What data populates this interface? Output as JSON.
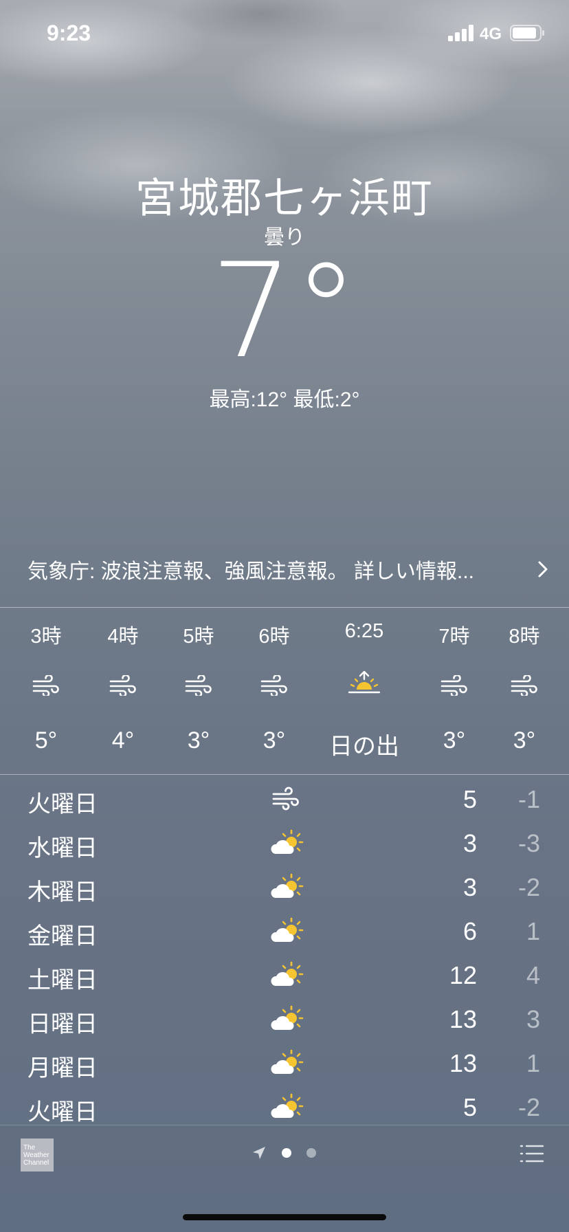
{
  "status_bar": {
    "time": "9:23",
    "network": "4G",
    "icons": [
      "signal-bars-icon",
      "battery-icon"
    ]
  },
  "header": {
    "location": "宮城郡七ヶ浜町",
    "condition": "曇り",
    "temperature": "7°",
    "hi_lo": "最高:12° 最低:2°"
  },
  "alert": {
    "text": "気象庁: 波浪注意報、強風注意報。 詳しい情報...",
    "icon": "chevron-right-icon"
  },
  "hourly": [
    {
      "time": "3時",
      "icon": "wind-icon",
      "temp": "5°"
    },
    {
      "time": "4時",
      "icon": "wind-icon",
      "temp": "4°"
    },
    {
      "time": "5時",
      "icon": "wind-icon",
      "temp": "3°"
    },
    {
      "time": "6時",
      "icon": "wind-icon",
      "temp": "3°"
    },
    {
      "time": "6:25",
      "icon": "sunrise-icon",
      "temp": "日の出"
    },
    {
      "time": "7時",
      "icon": "wind-icon",
      "temp": "3°"
    },
    {
      "time": "8時",
      "icon": "wind-icon",
      "temp": "3°"
    }
  ],
  "daily": [
    {
      "day": "火曜日",
      "icon": "wind-icon",
      "high": "5",
      "low": "-1"
    },
    {
      "day": "水曜日",
      "icon": "partly-cloudy-icon",
      "high": "3",
      "low": "-3"
    },
    {
      "day": "木曜日",
      "icon": "partly-cloudy-icon",
      "high": "3",
      "low": "-2"
    },
    {
      "day": "金曜日",
      "icon": "partly-cloudy-icon",
      "high": "6",
      "low": "1"
    },
    {
      "day": "土曜日",
      "icon": "partly-cloudy-icon",
      "high": "12",
      "low": "4"
    },
    {
      "day": "日曜日",
      "icon": "partly-cloudy-icon",
      "high": "13",
      "low": "3"
    },
    {
      "day": "月曜日",
      "icon": "partly-cloudy-icon",
      "high": "13",
      "low": "1"
    },
    {
      "day": "火曜日",
      "icon": "partly-cloudy-icon",
      "high": "5",
      "low": "-2"
    }
  ],
  "footer": {
    "logo_lines": [
      "The",
      "Weather",
      "Channel"
    ],
    "page_dots": 2,
    "active_page": 1,
    "icons": [
      "location-arrow-icon",
      "list-icon"
    ]
  },
  "colors": {
    "sun": "#f5c531",
    "text": "#ffffff",
    "muted_text": "rgba(255,255,255,0.55)"
  }
}
